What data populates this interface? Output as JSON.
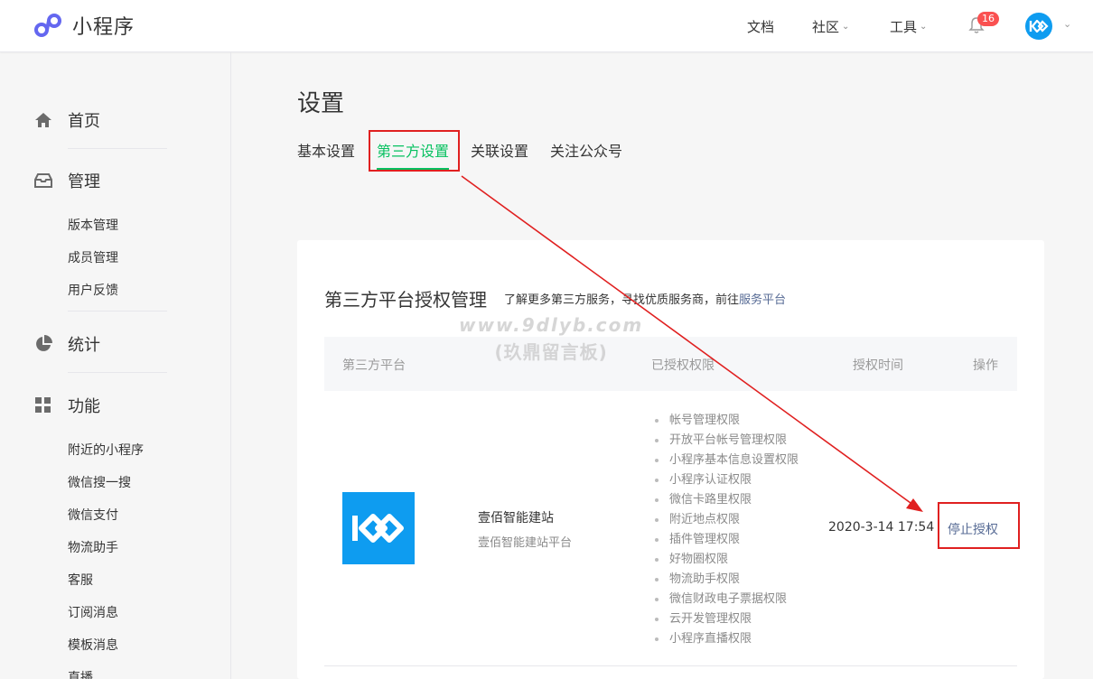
{
  "app": {
    "title": "小程序"
  },
  "topnav": {
    "docs": "文档",
    "community": "社区",
    "tools": "工具",
    "notification_count": "16"
  },
  "sidebar": {
    "sections": [
      {
        "label": "首页",
        "icon": "home-icon"
      },
      {
        "label": "管理",
        "icon": "inbox-icon",
        "items": [
          "版本管理",
          "成员管理",
          "用户反馈"
        ]
      },
      {
        "label": "统计",
        "icon": "pie-chart-icon"
      },
      {
        "label": "功能",
        "icon": "grid-icon",
        "items": [
          "附近的小程序",
          "微信搜一搜",
          "微信支付",
          "物流助手",
          "客服",
          "订阅消息",
          "模板消息",
          "直播"
        ]
      }
    ]
  },
  "main": {
    "title": "设置",
    "tabs": [
      {
        "label": "基本设置",
        "active": false
      },
      {
        "label": "第三方设置",
        "active": true
      },
      {
        "label": "关联设置",
        "active": false
      },
      {
        "label": "关注公众号",
        "active": false
      }
    ],
    "card": {
      "title": "第三方平台授权管理",
      "desc_prefix": "了解更多第三方服务，寻找优质服务商，前往",
      "desc_link": "服务平台",
      "columns": [
        "第三方平台",
        "已授权权限",
        "授权时间",
        "操作"
      ],
      "rows": [
        {
          "name": "壹佰智能建站",
          "subtitle": "壹佰智能建站平台",
          "permissions": [
            "帐号管理权限",
            "开放平台帐号管理权限",
            "小程序基本信息设置权限",
            "小程序认证权限",
            "微信卡路里权限",
            "附近地点权限",
            "插件管理权限",
            "好物圈权限",
            "物流助手权限",
            "微信财政电子票据权限",
            "云开发管理权限",
            "小程序直播权限"
          ],
          "time": "2020-3-14 17:54",
          "action": "停止授权"
        }
      ]
    }
  },
  "watermark": {
    "line1": "www.9dlyb.com",
    "line2": "(玖鼎留言板)"
  },
  "colors": {
    "accent": "#07c160",
    "link": "#576b95",
    "annotation": "#e02020",
    "brand_blue": "#0e9cf0"
  }
}
